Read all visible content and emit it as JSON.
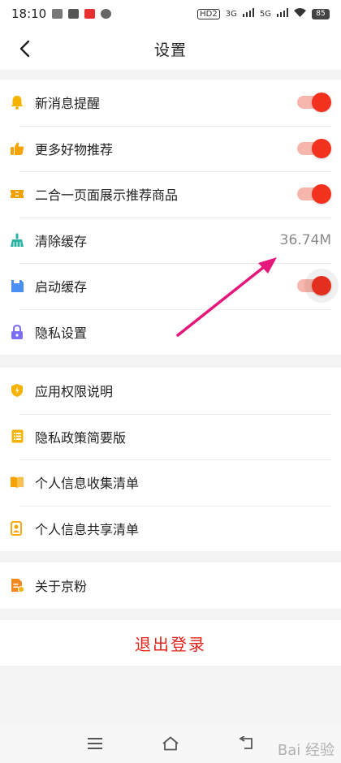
{
  "status_bar": {
    "time": "18:10",
    "hd_label": "HD2",
    "net1": "3G",
    "net2": "5G",
    "battery": "85"
  },
  "header": {
    "title": "设置"
  },
  "group1": [
    {
      "label": "新消息提醒",
      "icon": "bell-icon",
      "control": "toggle",
      "on": true,
      "icon_color": "#f5b300"
    },
    {
      "label": "更多好物推荐",
      "icon": "thumbs-up-icon",
      "control": "toggle",
      "on": true,
      "icon_color": "#f5a300"
    },
    {
      "label": "二合一页面展示推荐商品",
      "icon": "ticket-icon",
      "control": "toggle",
      "on": true,
      "icon_color": "#f0a000"
    },
    {
      "label": "清除缓存",
      "icon": "broom-icon",
      "control": "value",
      "value": "36.74M",
      "icon_color": "#2ab3a3"
    },
    {
      "label": "启动缓存",
      "icon": "save-icon",
      "control": "toggle",
      "on": true,
      "icon_color": "#4a8ef0"
    },
    {
      "label": "隐私设置",
      "icon": "lock-icon",
      "control": "none",
      "icon_color": "#7b6ef0"
    }
  ],
  "group2": [
    {
      "label": "应用权限说明",
      "icon": "shield-icon",
      "icon_color": "#f5b300"
    },
    {
      "label": "隐私政策简要版",
      "icon": "list-icon",
      "icon_color": "#f5b300"
    },
    {
      "label": "个人信息收集清单",
      "icon": "book-icon",
      "icon_color": "#f5a300"
    },
    {
      "label": "个人信息共享清单",
      "icon": "share-doc-icon",
      "icon_color": "#f5a300"
    }
  ],
  "group3": [
    {
      "label": "关于京粉",
      "icon": "info-doc-icon",
      "icon_color": "#f08a20"
    }
  ],
  "logout_label": "退出登录",
  "watermark": "Bai 经验",
  "colors": {
    "accent": "#e2231a",
    "toggle_knob": "#f2321f",
    "toggle_track": "#f7b6ad",
    "annotation_arrow": "#e5177a"
  }
}
